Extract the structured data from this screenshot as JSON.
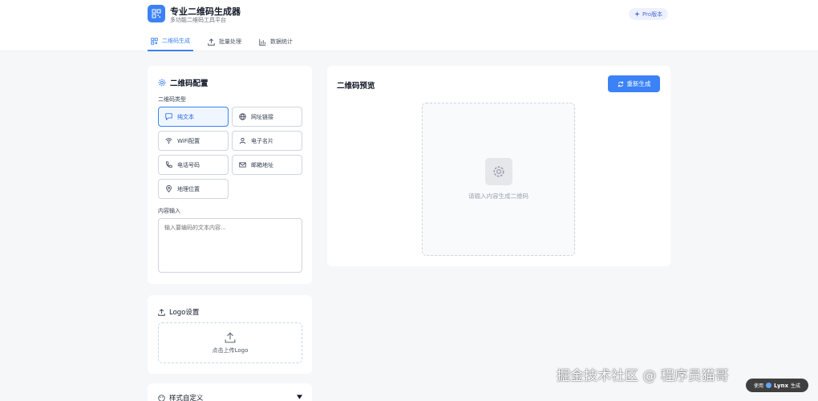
{
  "header": {
    "title": "专业二维码生成器",
    "subtitle": "多功能二维码工具平台",
    "pro_label": "Pro版本"
  },
  "tabs": [
    {
      "label": "二维码生成",
      "icon": "qr-icon",
      "active": true
    },
    {
      "label": "批量处理",
      "icon": "upload-icon",
      "active": false
    },
    {
      "label": "数据统计",
      "icon": "bar-chart-icon",
      "active": false
    }
  ],
  "config": {
    "title": "二维码配置",
    "type_label": "二维码类型",
    "types": [
      {
        "label": "纯文本",
        "icon": "message-icon",
        "selected": true
      },
      {
        "label": "网址链接",
        "icon": "globe-icon",
        "selected": false
      },
      {
        "label": "WiFi配置",
        "icon": "wifi-icon",
        "selected": false
      },
      {
        "label": "电子名片",
        "icon": "user-icon",
        "selected": false
      },
      {
        "label": "电话号码",
        "icon": "phone-icon",
        "selected": false
      },
      {
        "label": "邮箱地址",
        "icon": "mail-icon",
        "selected": false
      },
      {
        "label": "地理位置",
        "icon": "map-pin-icon",
        "selected": false
      }
    ],
    "content_label": "内容输入",
    "content_placeholder": "输入要编码的文本内容..."
  },
  "logo": {
    "title": "Logo设置",
    "upload_label": "点击上传Logo"
  },
  "style": {
    "title": "样式自定义"
  },
  "preview": {
    "title": "二维码预览",
    "regenerate_label": "重新生成",
    "placeholder": "请输入内容生成二维码"
  },
  "watermark": {
    "text": "掘金技术社区 @ 程序员猫哥",
    "badge_prefix": "使用",
    "badge_brand": "Lynx",
    "badge_suffix": "生成"
  },
  "colors": {
    "accent": "#3b82f6",
    "background": "#f6f7f9"
  }
}
